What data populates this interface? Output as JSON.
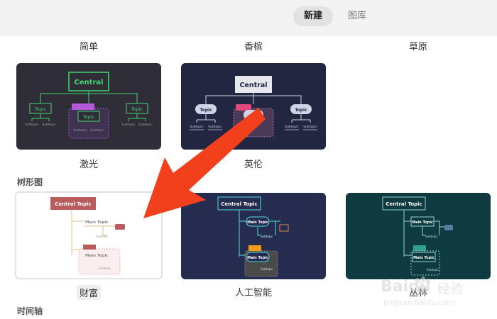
{
  "tabs": {
    "new_label": "新建",
    "gallery_label": "图库"
  },
  "top_row_labels": [
    "简单",
    "香槟",
    "草原"
  ],
  "sections": {
    "tree": "树形图",
    "timeline": "时间轴"
  },
  "themes_row1": [
    {
      "name": "激光",
      "central": "Central",
      "topic": "Topic",
      "subtopic": "Subtopic"
    },
    {
      "name": "英伦",
      "central": "Central",
      "topic": "Topic",
      "subtopic": "Subtopic"
    }
  ],
  "themes_row2": [
    {
      "name": "财富",
      "central": "Central Topic",
      "main": "Main Topic",
      "subtopic": "Subtopic"
    },
    {
      "name": "人工智能",
      "central": "Central Topic",
      "main": "Main Topic",
      "subtopic": "Subtopic"
    },
    {
      "name": "丛林",
      "central": "Central Topic",
      "main": "Main Topic",
      "subtopic": "Subtopic"
    }
  ],
  "watermark": {
    "brand": "Baidu",
    "suffix": "经验",
    "url": "jingyan.baidu.com"
  },
  "colors": {
    "arrow": "#f2401d",
    "laser_bg": "#2f2e38",
    "laser_green": "#44d66e",
    "british_bg": "#232641",
    "fortune_red": "#bb5c5c",
    "ai_bg": "#262c4f",
    "ai_cyan": "#4ee0e0",
    "jungle_bg": "#0f3b40"
  }
}
